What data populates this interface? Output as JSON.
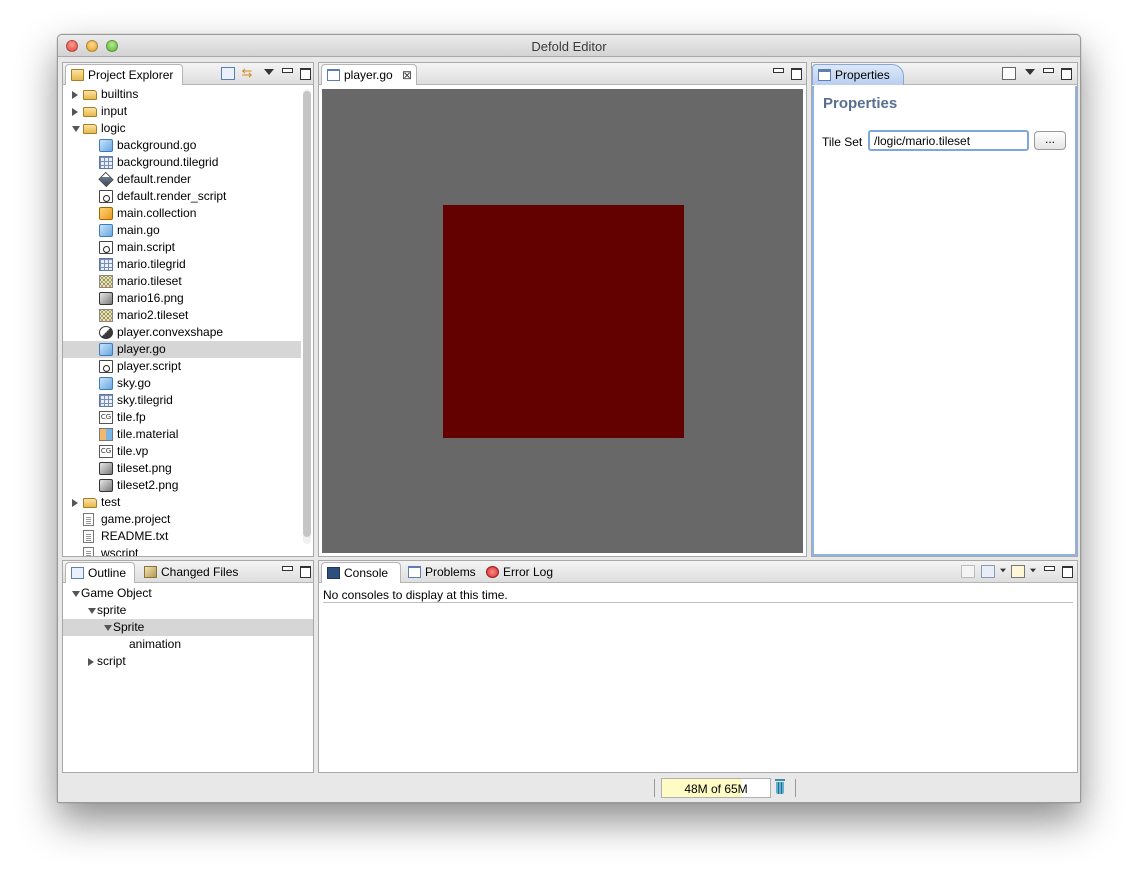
{
  "window": {
    "title": "Defold Editor"
  },
  "project_explorer": {
    "tab_label": "Project Explorer",
    "items": [
      {
        "label": "builtins",
        "icon": "folder-icon",
        "twisty": "closed",
        "depth": 0
      },
      {
        "label": "input",
        "icon": "folder-icon",
        "twisty": "closed",
        "depth": 0
      },
      {
        "label": "logic",
        "icon": "folder-open-icon",
        "twisty": "open",
        "depth": 0
      },
      {
        "label": "background.go",
        "icon": "game-object-icon",
        "depth": 1
      },
      {
        "label": "background.tilegrid",
        "icon": "tilegrid-icon",
        "depth": 1
      },
      {
        "label": "default.render",
        "icon": "render-icon",
        "depth": 1
      },
      {
        "label": "default.render_script",
        "icon": "script-icon",
        "depth": 1
      },
      {
        "label": "main.collection",
        "icon": "collection-icon",
        "depth": 1
      },
      {
        "label": "main.go",
        "icon": "game-object-icon",
        "depth": 1
      },
      {
        "label": "main.script",
        "icon": "script-icon",
        "depth": 1
      },
      {
        "label": "mario.tilegrid",
        "icon": "tilegrid-icon",
        "depth": 1
      },
      {
        "label": "mario.tileset",
        "icon": "tileset-icon",
        "depth": 1
      },
      {
        "label": "mario16.png",
        "icon": "png-icon",
        "depth": 1
      },
      {
        "label": "mario2.tileset",
        "icon": "tileset-icon",
        "depth": 1
      },
      {
        "label": "player.convexshape",
        "icon": "convexshape-icon",
        "depth": 1
      },
      {
        "label": "player.go",
        "icon": "game-object-icon",
        "depth": 1,
        "selected": true
      },
      {
        "label": "player.script",
        "icon": "script-icon",
        "depth": 1
      },
      {
        "label": "sky.go",
        "icon": "game-object-icon",
        "depth": 1
      },
      {
        "label": "sky.tilegrid",
        "icon": "tilegrid-icon",
        "depth": 1
      },
      {
        "label": "tile.fp",
        "icon": "cg-icon",
        "depth": 1
      },
      {
        "label": "tile.material",
        "icon": "material-icon",
        "depth": 1
      },
      {
        "label": "tile.vp",
        "icon": "cg-icon",
        "depth": 1
      },
      {
        "label": "tileset.png",
        "icon": "png-icon",
        "depth": 1
      },
      {
        "label": "tileset2.png",
        "icon": "png-icon",
        "depth": 1
      },
      {
        "label": "test",
        "icon": "folder-icon",
        "twisty": "closed",
        "depth": 0
      },
      {
        "label": "game.project",
        "icon": "file-icon",
        "depth": 0
      },
      {
        "label": "README.txt",
        "icon": "file-icon",
        "depth": 0
      },
      {
        "label": "wscript",
        "icon": "file-icon",
        "depth": 0
      }
    ]
  },
  "editor": {
    "tab_label": "player.go",
    "sprite_color": "#630000",
    "background_color": "#686868"
  },
  "properties": {
    "tab_label": "Properties",
    "heading": "Properties",
    "tile_set_label": "Tile Set",
    "tile_set_value": "/logic/mario.tileset",
    "browse_label": "..."
  },
  "outline": {
    "tab_label": "Outline",
    "changed_files_tab_label": "Changed Files",
    "items": [
      {
        "label": "Game Object",
        "twisty": "open",
        "depth": 0
      },
      {
        "label": "sprite",
        "twisty": "open",
        "depth": 1
      },
      {
        "label": "Sprite",
        "twisty": "open",
        "depth": 2,
        "selected": true
      },
      {
        "label": "animation",
        "depth": 3
      },
      {
        "label": "script",
        "twisty": "closed",
        "depth": 1
      }
    ]
  },
  "bottom_panel": {
    "console_tab_label": "Console",
    "problems_tab_label": "Problems",
    "error_log_tab_label": "Error Log",
    "console_message": "No consoles to display at this time."
  },
  "status": {
    "heap_label": "48M of 65M",
    "heap_used_fraction": 0.74
  }
}
